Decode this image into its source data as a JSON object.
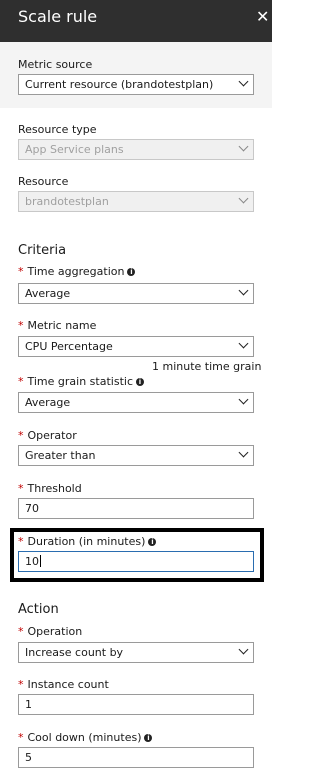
{
  "header": {
    "title": "Scale rule",
    "close_icon": "close-icon"
  },
  "metric_source": {
    "label": "Metric source",
    "value": "Current resource (brandotestplan)"
  },
  "resource_type": {
    "label": "Resource type",
    "value": "App Service plans"
  },
  "resource": {
    "label": "Resource",
    "value": "brandotestplan"
  },
  "criteria": {
    "heading": "Criteria",
    "time_aggregation": {
      "label": "Time aggregation",
      "value": "Average"
    },
    "metric_name": {
      "label": "Metric name",
      "value": "CPU Percentage",
      "hint": "1 minute time grain"
    },
    "time_grain_statistic": {
      "label": "Time grain statistic",
      "value": "Average"
    },
    "operator": {
      "label": "Operator",
      "value": "Greater than"
    },
    "threshold": {
      "label": "Threshold",
      "value": "70"
    },
    "duration": {
      "label": "Duration (in minutes)",
      "value": "10"
    }
  },
  "action": {
    "heading": "Action",
    "operation": {
      "label": "Operation",
      "value": "Increase count by"
    },
    "instance_count": {
      "label": "Instance count",
      "value": "1"
    },
    "cool_down": {
      "label": "Cool down (minutes)",
      "value": "5"
    }
  },
  "glyphs": {
    "required": "*",
    "info": "i",
    "close": "✕"
  },
  "colors": {
    "titlebar": "#2f2f2f",
    "required": "#c00000",
    "focus_border": "#2a6db0",
    "highlight_frame": "#000000"
  }
}
